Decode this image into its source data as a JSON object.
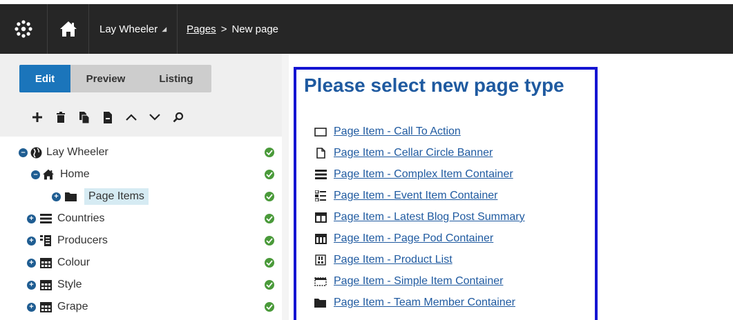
{
  "header": {
    "site_name": "Lay Wheeler",
    "breadcrumb_link": "Pages",
    "breadcrumb_separator": ">",
    "breadcrumb_current": "New page"
  },
  "tabs": [
    {
      "label": "Edit",
      "active": true
    },
    {
      "label": "Preview",
      "active": false
    },
    {
      "label": "Listing",
      "active": false
    }
  ],
  "tree": [
    {
      "label": "Lay Wheeler",
      "level": 0,
      "expanded": true,
      "icon": "globe-icon",
      "status": "published"
    },
    {
      "label": "Home",
      "level": 1,
      "expanded": true,
      "icon": "house-icon",
      "status": "published"
    },
    {
      "label": "Page Items",
      "level": 2,
      "expanded": false,
      "icon": "folder-icon",
      "status": "published",
      "selected": true
    },
    {
      "label": "Countries",
      "level": 1,
      "expanded": false,
      "icon": "list-lines-icon",
      "status": "published"
    },
    {
      "label": "Producers",
      "level": 1,
      "expanded": false,
      "icon": "grid-list-icon",
      "status": "published"
    },
    {
      "label": "Colour",
      "level": 1,
      "expanded": false,
      "icon": "table-icon",
      "status": "published"
    },
    {
      "label": "Style",
      "level": 1,
      "expanded": false,
      "icon": "table-icon",
      "status": "published"
    },
    {
      "label": "Grape",
      "level": 1,
      "expanded": false,
      "icon": "table-icon",
      "status": "published"
    }
  ],
  "select": {
    "title": "Please select new page type",
    "types": [
      {
        "label": "Page Item - Call To Action",
        "icon": "rectangle-icon"
      },
      {
        "label": "Page Item - Cellar Circle Banner",
        "icon": "document-icon"
      },
      {
        "label": "Page Item - Complex Item Container",
        "icon": "lines-icon"
      },
      {
        "label": "Page Item - Event Item Container",
        "icon": "event-list-icon"
      },
      {
        "label": "Page Item - Latest Blog Post Summary",
        "icon": "columns-icon"
      },
      {
        "label": "Page Item - Page Pod Container",
        "icon": "pods-icon"
      },
      {
        "label": "Page Item - Product List",
        "icon": "product-list-icon"
      },
      {
        "label": "Page Item - Simple Item Container",
        "icon": "dashed-box-icon"
      },
      {
        "label": "Page Item - Team Member Container",
        "icon": "folder-icon"
      }
    ]
  }
}
